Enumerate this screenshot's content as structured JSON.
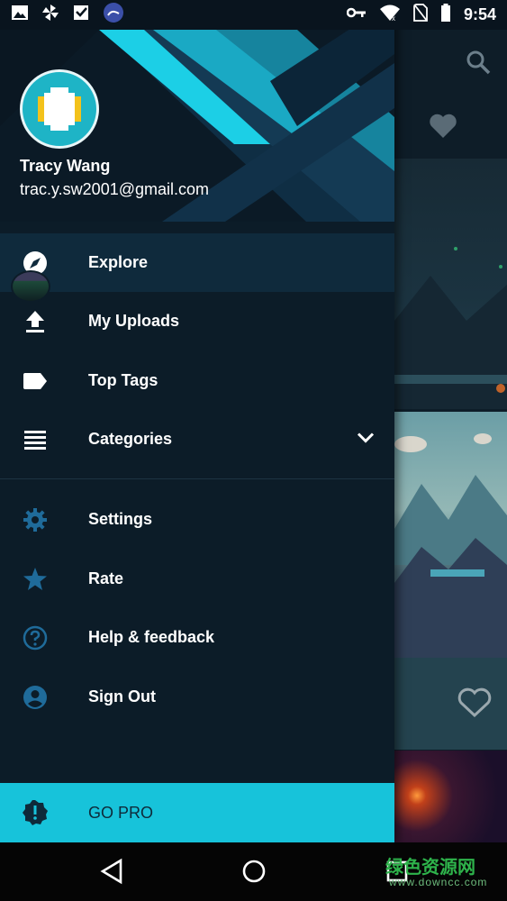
{
  "status_bar": {
    "time": "9:54",
    "left_icons": [
      "image-icon",
      "pinwheel-icon",
      "checklist-icon",
      "app-notification-icon"
    ],
    "right_icons": [
      "vpn-key-icon",
      "wifi-icon",
      "no-sim-icon",
      "battery-icon"
    ]
  },
  "drawer": {
    "user": {
      "name": "Tracy Wang",
      "email": "trac.y.sw2001@gmail.com"
    },
    "menu_primary": [
      {
        "label": "Explore",
        "icon": "compass-icon",
        "active": true
      },
      {
        "label": "My Uploads",
        "icon": "upload-icon",
        "active": false
      },
      {
        "label": "Top Tags",
        "icon": "tag-icon",
        "active": false
      },
      {
        "label": "Categories",
        "icon": "list-icon",
        "active": false,
        "expandable": true
      }
    ],
    "menu_secondary": [
      {
        "label": "Settings",
        "icon": "gear-icon"
      },
      {
        "label": "Rate",
        "icon": "star-icon"
      },
      {
        "label": "Help & feedback",
        "icon": "help-icon"
      },
      {
        "label": "Sign Out",
        "icon": "account-icon"
      }
    ],
    "go_pro": {
      "label": "GO PRO",
      "icon": "alert-badge-icon"
    }
  },
  "nav_bar": {
    "buttons": [
      "back-icon",
      "home-icon",
      "recents-icon"
    ]
  },
  "watermark": {
    "text": "绿色资源网",
    "sub": "www.downcc.com"
  },
  "colors": {
    "drawer_bg": "#0c1c28",
    "active_item_bg": "#0f2a3c",
    "accent": "#17c3da",
    "icon_blue": "#1f6b9a"
  }
}
